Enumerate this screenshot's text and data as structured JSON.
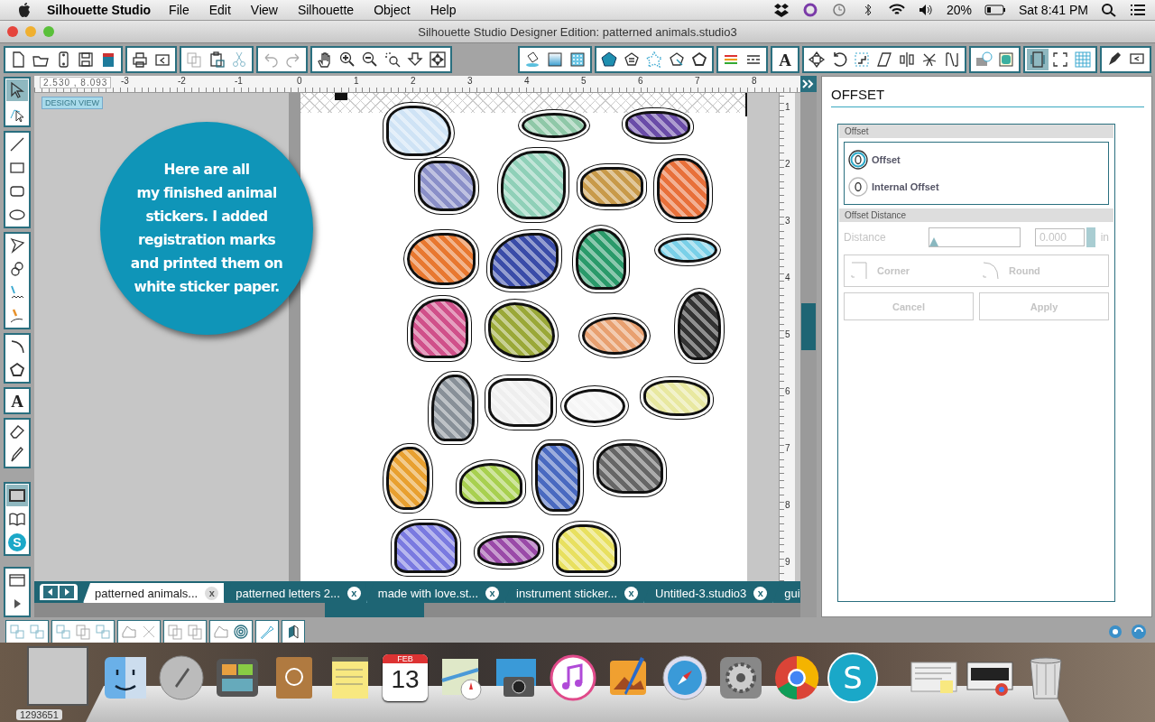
{
  "menu_bar": {
    "app_name": "Silhouette Studio",
    "menus": [
      "File",
      "Edit",
      "View",
      "Silhouette",
      "Object",
      "Help"
    ],
    "battery": "20%",
    "clock": "Sat 8:41 PM"
  },
  "window": {
    "title": "Silhouette Studio Designer Edition: patterned animals.studio3"
  },
  "toolbar": {
    "text_glyph": "A"
  },
  "tools": {
    "text_glyph": "A",
    "logo_glyph": "S"
  },
  "ruler": {
    "coordinates": "2.530 , 8.093",
    "top_marks": [
      "-3",
      "-2",
      "-1",
      "0",
      "1",
      "2",
      "3",
      "4",
      "5",
      "6",
      "7",
      "8"
    ],
    "side_marks": [
      "1",
      "2",
      "3",
      "4",
      "5",
      "6",
      "7",
      "8",
      "9"
    ]
  },
  "view_badge": "DESIGN VIEW",
  "callout": {
    "lines": [
      "Here are all",
      "my finished animal",
      "stickers. I added",
      "registration marks",
      "and printed them on",
      "white sticker paper."
    ]
  },
  "tabs": [
    {
      "label": "patterned animals...",
      "close": "x",
      "selected": true
    },
    {
      "label": "patterned letters 2...",
      "close": "x",
      "selected": false
    },
    {
      "label": "made with love.st...",
      "close": "x",
      "selected": false
    },
    {
      "label": "instrument sticker...",
      "close": "x",
      "selected": false
    },
    {
      "label": "Untitled-3.studio3",
      "close": "x",
      "selected": false
    },
    {
      "label": "gui",
      "selected": false
    }
  ],
  "panel": {
    "title": "OFFSET",
    "offset_section": "Offset",
    "options": [
      {
        "label": "Offset",
        "selected": true
      },
      {
        "label": "Internal Offset",
        "selected": false
      }
    ],
    "distance_section": "Offset Distance",
    "distance": {
      "label": "Distance",
      "level": 0,
      "value": "0.000",
      "unit": "in"
    },
    "corners": [
      {
        "label": "Corner",
        "kind": "corner"
      },
      {
        "label": "Round",
        "kind": "round"
      }
    ],
    "buttons": [
      "Cancel",
      "Apply"
    ],
    "disabled": true
  },
  "dock": {
    "calendar_month": "FEB",
    "calendar_day": "13",
    "app_logo": "S",
    "partial_label": "1293651"
  }
}
